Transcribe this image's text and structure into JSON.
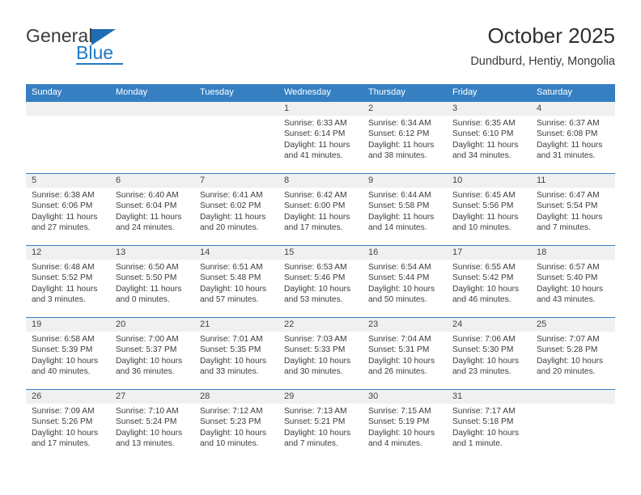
{
  "brand": {
    "name_top": "General",
    "name_bottom": "Blue"
  },
  "header": {
    "title": "October 2025",
    "subtitle": "Dundburd, Hentiy, Mongolia"
  },
  "colors": {
    "header_blue": "#3680c2",
    "logo_blue": "#2079c6",
    "daynum_band": "#f0f0f0"
  },
  "weekdays": [
    "Sunday",
    "Monday",
    "Tuesday",
    "Wednesday",
    "Thursday",
    "Friday",
    "Saturday"
  ],
  "weeks": [
    [
      {
        "day": "",
        "sunrise": "",
        "sunset": "",
        "daylight_line1": "",
        "daylight_line2": ""
      },
      {
        "day": "",
        "sunrise": "",
        "sunset": "",
        "daylight_line1": "",
        "daylight_line2": ""
      },
      {
        "day": "",
        "sunrise": "",
        "sunset": "",
        "daylight_line1": "",
        "daylight_line2": ""
      },
      {
        "day": "1",
        "sunrise": "Sunrise: 6:33 AM",
        "sunset": "Sunset: 6:14 PM",
        "daylight_line1": "Daylight: 11 hours",
        "daylight_line2": "and 41 minutes."
      },
      {
        "day": "2",
        "sunrise": "Sunrise: 6:34 AM",
        "sunset": "Sunset: 6:12 PM",
        "daylight_line1": "Daylight: 11 hours",
        "daylight_line2": "and 38 minutes."
      },
      {
        "day": "3",
        "sunrise": "Sunrise: 6:35 AM",
        "sunset": "Sunset: 6:10 PM",
        "daylight_line1": "Daylight: 11 hours",
        "daylight_line2": "and 34 minutes."
      },
      {
        "day": "4",
        "sunrise": "Sunrise: 6:37 AM",
        "sunset": "Sunset: 6:08 PM",
        "daylight_line1": "Daylight: 11 hours",
        "daylight_line2": "and 31 minutes."
      }
    ],
    [
      {
        "day": "5",
        "sunrise": "Sunrise: 6:38 AM",
        "sunset": "Sunset: 6:06 PM",
        "daylight_line1": "Daylight: 11 hours",
        "daylight_line2": "and 27 minutes."
      },
      {
        "day": "6",
        "sunrise": "Sunrise: 6:40 AM",
        "sunset": "Sunset: 6:04 PM",
        "daylight_line1": "Daylight: 11 hours",
        "daylight_line2": "and 24 minutes."
      },
      {
        "day": "7",
        "sunrise": "Sunrise: 6:41 AM",
        "sunset": "Sunset: 6:02 PM",
        "daylight_line1": "Daylight: 11 hours",
        "daylight_line2": "and 20 minutes."
      },
      {
        "day": "8",
        "sunrise": "Sunrise: 6:42 AM",
        "sunset": "Sunset: 6:00 PM",
        "daylight_line1": "Daylight: 11 hours",
        "daylight_line2": "and 17 minutes."
      },
      {
        "day": "9",
        "sunrise": "Sunrise: 6:44 AM",
        "sunset": "Sunset: 5:58 PM",
        "daylight_line1": "Daylight: 11 hours",
        "daylight_line2": "and 14 minutes."
      },
      {
        "day": "10",
        "sunrise": "Sunrise: 6:45 AM",
        "sunset": "Sunset: 5:56 PM",
        "daylight_line1": "Daylight: 11 hours",
        "daylight_line2": "and 10 minutes."
      },
      {
        "day": "11",
        "sunrise": "Sunrise: 6:47 AM",
        "sunset": "Sunset: 5:54 PM",
        "daylight_line1": "Daylight: 11 hours",
        "daylight_line2": "and 7 minutes."
      }
    ],
    [
      {
        "day": "12",
        "sunrise": "Sunrise: 6:48 AM",
        "sunset": "Sunset: 5:52 PM",
        "daylight_line1": "Daylight: 11 hours",
        "daylight_line2": "and 3 minutes."
      },
      {
        "day": "13",
        "sunrise": "Sunrise: 6:50 AM",
        "sunset": "Sunset: 5:50 PM",
        "daylight_line1": "Daylight: 11 hours",
        "daylight_line2": "and 0 minutes."
      },
      {
        "day": "14",
        "sunrise": "Sunrise: 6:51 AM",
        "sunset": "Sunset: 5:48 PM",
        "daylight_line1": "Daylight: 10 hours",
        "daylight_line2": "and 57 minutes."
      },
      {
        "day": "15",
        "sunrise": "Sunrise: 6:53 AM",
        "sunset": "Sunset: 5:46 PM",
        "daylight_line1": "Daylight: 10 hours",
        "daylight_line2": "and 53 minutes."
      },
      {
        "day": "16",
        "sunrise": "Sunrise: 6:54 AM",
        "sunset": "Sunset: 5:44 PM",
        "daylight_line1": "Daylight: 10 hours",
        "daylight_line2": "and 50 minutes."
      },
      {
        "day": "17",
        "sunrise": "Sunrise: 6:55 AM",
        "sunset": "Sunset: 5:42 PM",
        "daylight_line1": "Daylight: 10 hours",
        "daylight_line2": "and 46 minutes."
      },
      {
        "day": "18",
        "sunrise": "Sunrise: 6:57 AM",
        "sunset": "Sunset: 5:40 PM",
        "daylight_line1": "Daylight: 10 hours",
        "daylight_line2": "and 43 minutes."
      }
    ],
    [
      {
        "day": "19",
        "sunrise": "Sunrise: 6:58 AM",
        "sunset": "Sunset: 5:39 PM",
        "daylight_line1": "Daylight: 10 hours",
        "daylight_line2": "and 40 minutes."
      },
      {
        "day": "20",
        "sunrise": "Sunrise: 7:00 AM",
        "sunset": "Sunset: 5:37 PM",
        "daylight_line1": "Daylight: 10 hours",
        "daylight_line2": "and 36 minutes."
      },
      {
        "day": "21",
        "sunrise": "Sunrise: 7:01 AM",
        "sunset": "Sunset: 5:35 PM",
        "daylight_line1": "Daylight: 10 hours",
        "daylight_line2": "and 33 minutes."
      },
      {
        "day": "22",
        "sunrise": "Sunrise: 7:03 AM",
        "sunset": "Sunset: 5:33 PM",
        "daylight_line1": "Daylight: 10 hours",
        "daylight_line2": "and 30 minutes."
      },
      {
        "day": "23",
        "sunrise": "Sunrise: 7:04 AM",
        "sunset": "Sunset: 5:31 PM",
        "daylight_line1": "Daylight: 10 hours",
        "daylight_line2": "and 26 minutes."
      },
      {
        "day": "24",
        "sunrise": "Sunrise: 7:06 AM",
        "sunset": "Sunset: 5:30 PM",
        "daylight_line1": "Daylight: 10 hours",
        "daylight_line2": "and 23 minutes."
      },
      {
        "day": "25",
        "sunrise": "Sunrise: 7:07 AM",
        "sunset": "Sunset: 5:28 PM",
        "daylight_line1": "Daylight: 10 hours",
        "daylight_line2": "and 20 minutes."
      }
    ],
    [
      {
        "day": "26",
        "sunrise": "Sunrise: 7:09 AM",
        "sunset": "Sunset: 5:26 PM",
        "daylight_line1": "Daylight: 10 hours",
        "daylight_line2": "and 17 minutes."
      },
      {
        "day": "27",
        "sunrise": "Sunrise: 7:10 AM",
        "sunset": "Sunset: 5:24 PM",
        "daylight_line1": "Daylight: 10 hours",
        "daylight_line2": "and 13 minutes."
      },
      {
        "day": "28",
        "sunrise": "Sunrise: 7:12 AM",
        "sunset": "Sunset: 5:23 PM",
        "daylight_line1": "Daylight: 10 hours",
        "daylight_line2": "and 10 minutes."
      },
      {
        "day": "29",
        "sunrise": "Sunrise: 7:13 AM",
        "sunset": "Sunset: 5:21 PM",
        "daylight_line1": "Daylight: 10 hours",
        "daylight_line2": "and 7 minutes."
      },
      {
        "day": "30",
        "sunrise": "Sunrise: 7:15 AM",
        "sunset": "Sunset: 5:19 PM",
        "daylight_line1": "Daylight: 10 hours",
        "daylight_line2": "and 4 minutes."
      },
      {
        "day": "31",
        "sunrise": "Sunrise: 7:17 AM",
        "sunset": "Sunset: 5:18 PM",
        "daylight_line1": "Daylight: 10 hours",
        "daylight_line2": "and 1 minute."
      },
      {
        "day": "",
        "sunrise": "",
        "sunset": "",
        "daylight_line1": "",
        "daylight_line2": ""
      }
    ]
  ]
}
